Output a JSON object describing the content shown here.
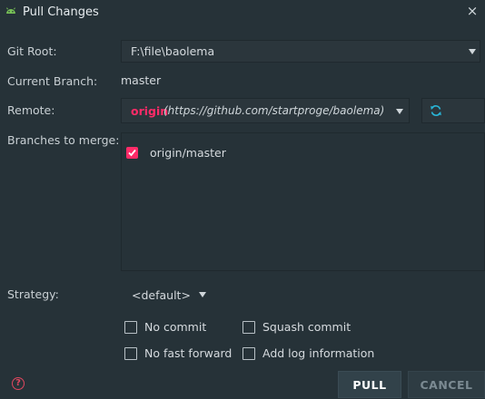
{
  "window": {
    "title": "Pull Changes",
    "close_glyph": "×"
  },
  "form": {
    "git_root": {
      "label": "Git Root:",
      "value": "F:\\file\\baolema"
    },
    "current_branch": {
      "label": "Current Branch:",
      "value": "master"
    },
    "remote": {
      "label": "Remote:",
      "name": "origin",
      "url": "(https://github.com/startproge/baolema)"
    },
    "branches": {
      "label": "Branches to merge:",
      "items": [
        {
          "label": "origin/master",
          "checked": true
        }
      ]
    },
    "strategy": {
      "label": "Strategy:",
      "value": "<default>"
    },
    "options": {
      "no_commit": "No commit",
      "squash_commit": "Squash commit",
      "no_fast_forward": "No fast forward",
      "add_log": "Add log information"
    }
  },
  "buttons": {
    "help": "?",
    "pull": "PULL",
    "cancel": "CANCEL"
  },
  "colors": {
    "background": "#263238",
    "accent": "#ff2b68",
    "refresh_icon": "#29b6d8",
    "help_icon": "#e0475f"
  }
}
